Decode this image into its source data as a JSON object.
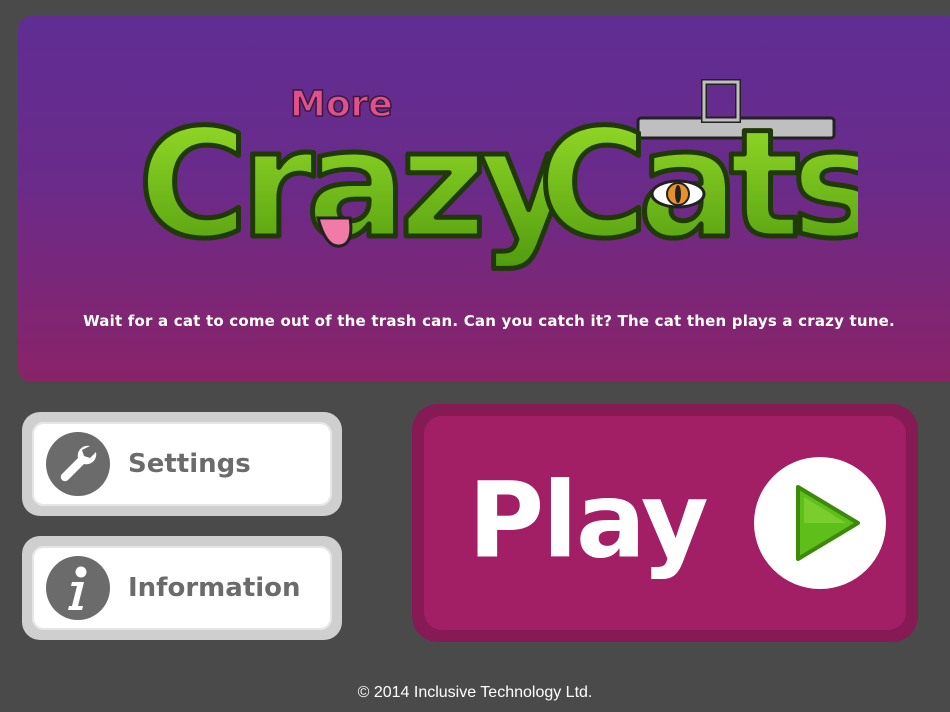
{
  "banner": {
    "logo": {
      "more": "More",
      "title_part1": "Crazy",
      "title_part2": "Cats"
    },
    "instructions": "Wait for a cat to come out of the trash can. Can you catch it? The cat then plays a crazy tune."
  },
  "buttons": {
    "settings": {
      "label": "Settings",
      "icon": "wrench-icon"
    },
    "information": {
      "label": "Information",
      "icon": "info-icon"
    },
    "play": {
      "label": "Play",
      "icon": "play-icon"
    }
  },
  "footer": {
    "copyright": "© 2014 Inclusive Technology Ltd."
  },
  "colors": {
    "background": "#4a4a4a",
    "banner_top": "#5f2d93",
    "banner_bottom": "#8a2368",
    "logo_green": "#7cc418",
    "logo_pink": "#e0508a",
    "play_outer": "#861a55",
    "play_inner": "#a21f66",
    "side_button_gray": "#6b6b6b",
    "play_arrow": "#5fbf1a"
  }
}
